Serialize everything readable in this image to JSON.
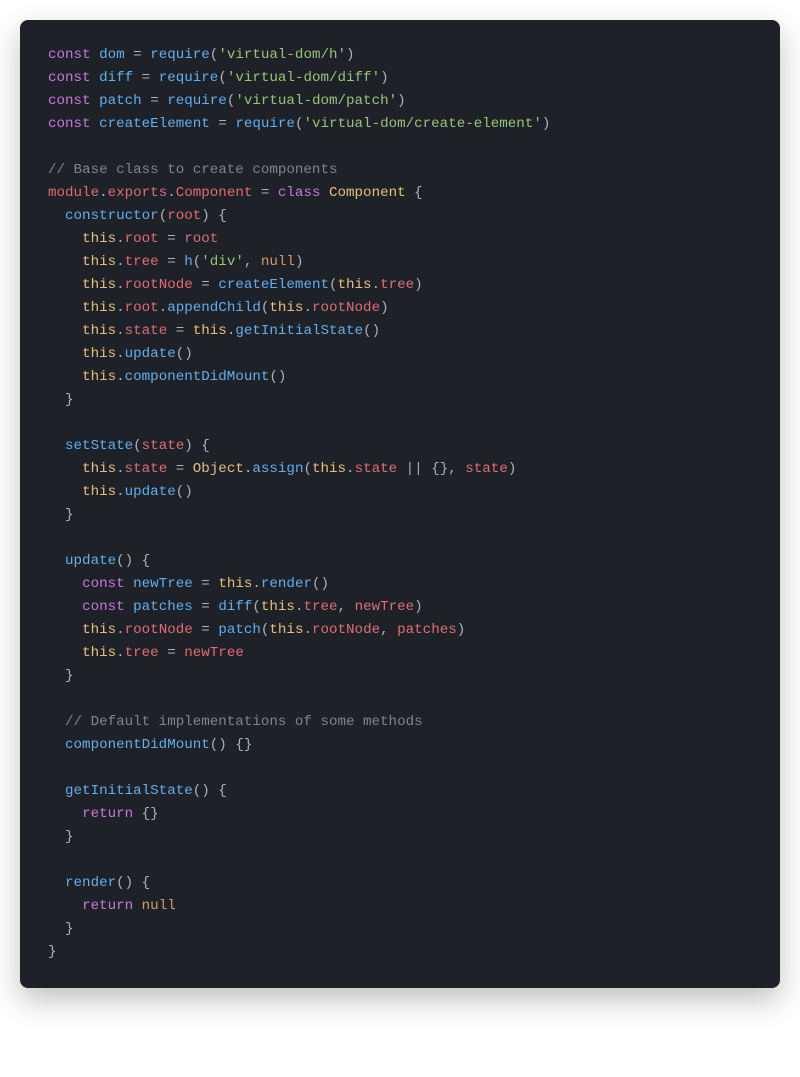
{
  "code": {
    "lines": [
      {
        "type": "require",
        "varName": "dom",
        "path": "virtual-dom/h"
      },
      {
        "type": "require",
        "varName": "diff",
        "path": "virtual-dom/diff"
      },
      {
        "type": "require",
        "varName": "patch",
        "path": "virtual-dom/patch"
      },
      {
        "type": "require",
        "varName": "createElement",
        "path": "virtual-dom/create-element"
      },
      {
        "type": "blank"
      },
      {
        "type": "comment",
        "text": "// Base class to create components"
      },
      {
        "type": "classDecl",
        "exportPath": "module.exports.Component",
        "className": "Component"
      },
      {
        "type": "methodOpen",
        "indent": 1,
        "name": "constructor",
        "params": "root"
      },
      {
        "type": "assignThis",
        "indent": 2,
        "prop": "root",
        "rhsVar": "root"
      },
      {
        "type": "assignThisCall",
        "indent": 2,
        "prop": "tree",
        "fn": "h",
        "argsStr": "'div'",
        "argsNull": true
      },
      {
        "type": "assignThisFnOnThis",
        "indent": 2,
        "prop": "rootNode",
        "fn": "createElement",
        "thisProp": "tree"
      },
      {
        "type": "thisMethodCallArg",
        "indent": 2,
        "target": "root",
        "method": "appendChild",
        "argThisProp": "rootNode"
      },
      {
        "type": "assignThisFromThisCall",
        "indent": 2,
        "prop": "state",
        "method": "getInitialState"
      },
      {
        "type": "thisCall",
        "indent": 2,
        "method": "update"
      },
      {
        "type": "thisCall",
        "indent": 2,
        "method": "componentDidMount"
      },
      {
        "type": "close",
        "indent": 1
      },
      {
        "type": "blank"
      },
      {
        "type": "methodOpen",
        "indent": 1,
        "name": "setState",
        "params": "state"
      },
      {
        "type": "setStateAssign",
        "indent": 2
      },
      {
        "type": "thisCall",
        "indent": 2,
        "method": "update"
      },
      {
        "type": "close",
        "indent": 1
      },
      {
        "type": "blank"
      },
      {
        "type": "methodOpen",
        "indent": 1,
        "name": "update",
        "params": ""
      },
      {
        "type": "constFromThisCall",
        "indent": 2,
        "varName": "newTree",
        "method": "render"
      },
      {
        "type": "constDiff",
        "indent": 2,
        "varName": "patches",
        "fn": "diff",
        "arg1ThisProp": "tree",
        "arg2Var": "newTree"
      },
      {
        "type": "assignThisPatch",
        "indent": 2,
        "prop": "rootNode",
        "fn": "patch",
        "arg1ThisProp": "rootNode",
        "arg2Var": "patches"
      },
      {
        "type": "assignThis",
        "indent": 2,
        "prop": "tree",
        "rhsVar": "newTree"
      },
      {
        "type": "close",
        "indent": 1
      },
      {
        "type": "blank"
      },
      {
        "type": "comment",
        "indent": 1,
        "text": "// Default implementations of some methods"
      },
      {
        "type": "emptyMethod",
        "indent": 1,
        "name": "componentDidMount"
      },
      {
        "type": "blank"
      },
      {
        "type": "methodOpen",
        "indent": 1,
        "name": "getInitialState",
        "params": ""
      },
      {
        "type": "returnEmptyObj",
        "indent": 2
      },
      {
        "type": "close",
        "indent": 1
      },
      {
        "type": "blank"
      },
      {
        "type": "methodOpen",
        "indent": 1,
        "name": "render",
        "params": ""
      },
      {
        "type": "returnNull",
        "indent": 2
      },
      {
        "type": "close",
        "indent": 1
      },
      {
        "type": "close",
        "indent": 0
      }
    ]
  }
}
